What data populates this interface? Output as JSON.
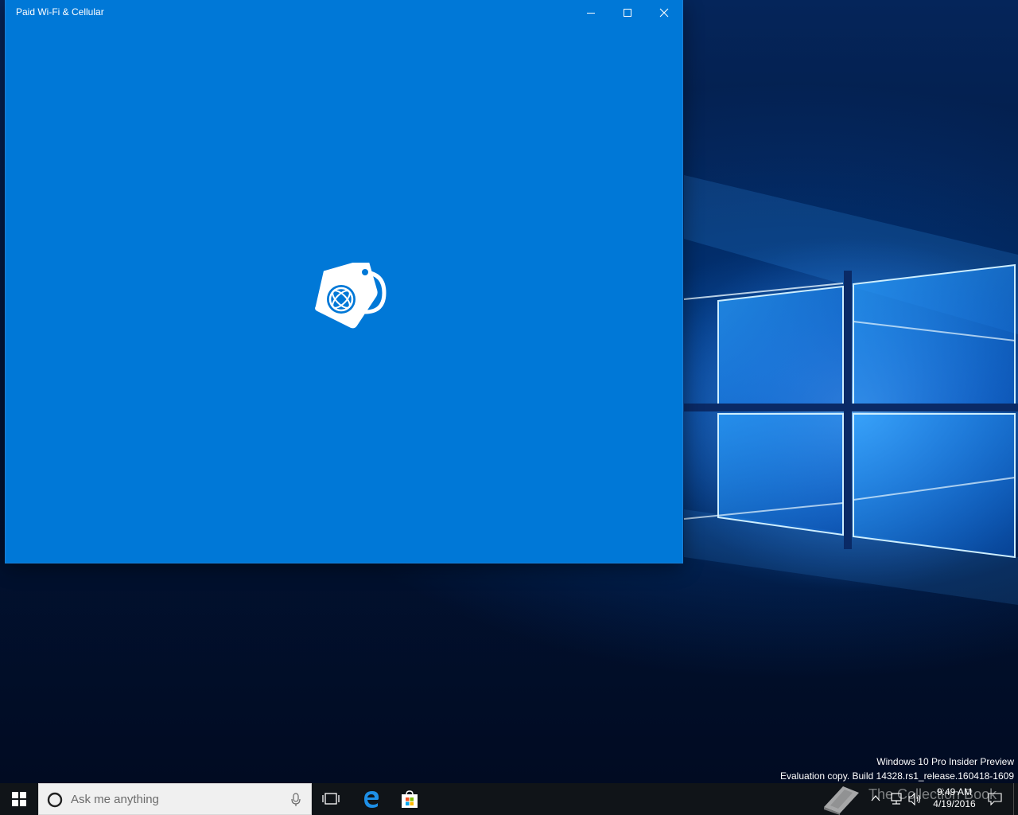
{
  "window": {
    "title": "Paid Wi-Fi & Cellular",
    "background_color": "#0078d7",
    "controls": {
      "minimize_icon": "minimize-icon",
      "maximize_icon": "maximize-icon",
      "close_icon": "close-icon"
    },
    "splash_icon": "paid-wifi-tag-icon"
  },
  "desktop": {
    "watermark_line1": "Windows 10 Pro Insider Preview",
    "watermark_line2": "Evaluation copy. Build 14328.rs1_release.160418-1609"
  },
  "taskbar": {
    "start_icon": "windows-logo-icon",
    "search_placeholder": "Ask me anything",
    "pinned_apps": [
      {
        "name": "Task View",
        "icon": "task-view-icon"
      },
      {
        "name": "Microsoft Edge",
        "icon": "edge-icon"
      },
      {
        "name": "Store",
        "icon": "store-icon"
      }
    ],
    "overlay_text": "The Collection Book",
    "tray": {
      "time": "9:49 AM",
      "date": "4/19/2016"
    },
    "background_color": "#101418"
  }
}
